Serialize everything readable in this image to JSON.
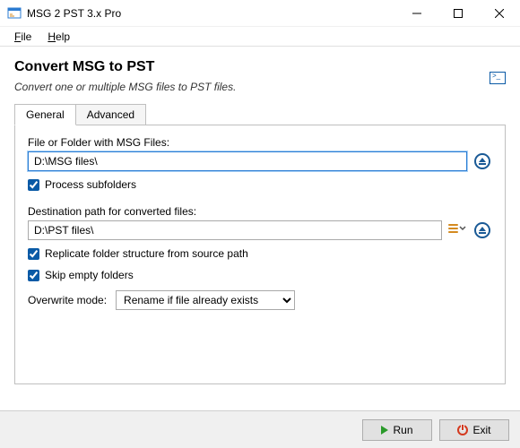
{
  "window": {
    "title": "MSG 2 PST 3.x Pro"
  },
  "menubar": {
    "file": "File",
    "help": "Help"
  },
  "header": {
    "title": "Convert MSG to PST",
    "subtitle": "Convert one or multiple MSG files to PST files."
  },
  "tabs": {
    "general": "General",
    "advanced": "Advanced"
  },
  "fields": {
    "source_label": "File or Folder with MSG Files:",
    "source_value": "D:\\MSG files\\",
    "process_subfolders": "Process subfolders",
    "process_subfolders_checked": true,
    "dest_label": "Destination path for converted files:",
    "dest_value": "D:\\PST files\\",
    "replicate": "Replicate folder structure from source path",
    "replicate_checked": true,
    "skip_empty": "Skip empty folders",
    "skip_empty_checked": true,
    "overwrite_label": "Overwrite mode:",
    "overwrite_value": "Rename if file already exists"
  },
  "buttons": {
    "run": "Run",
    "exit": "Exit"
  }
}
